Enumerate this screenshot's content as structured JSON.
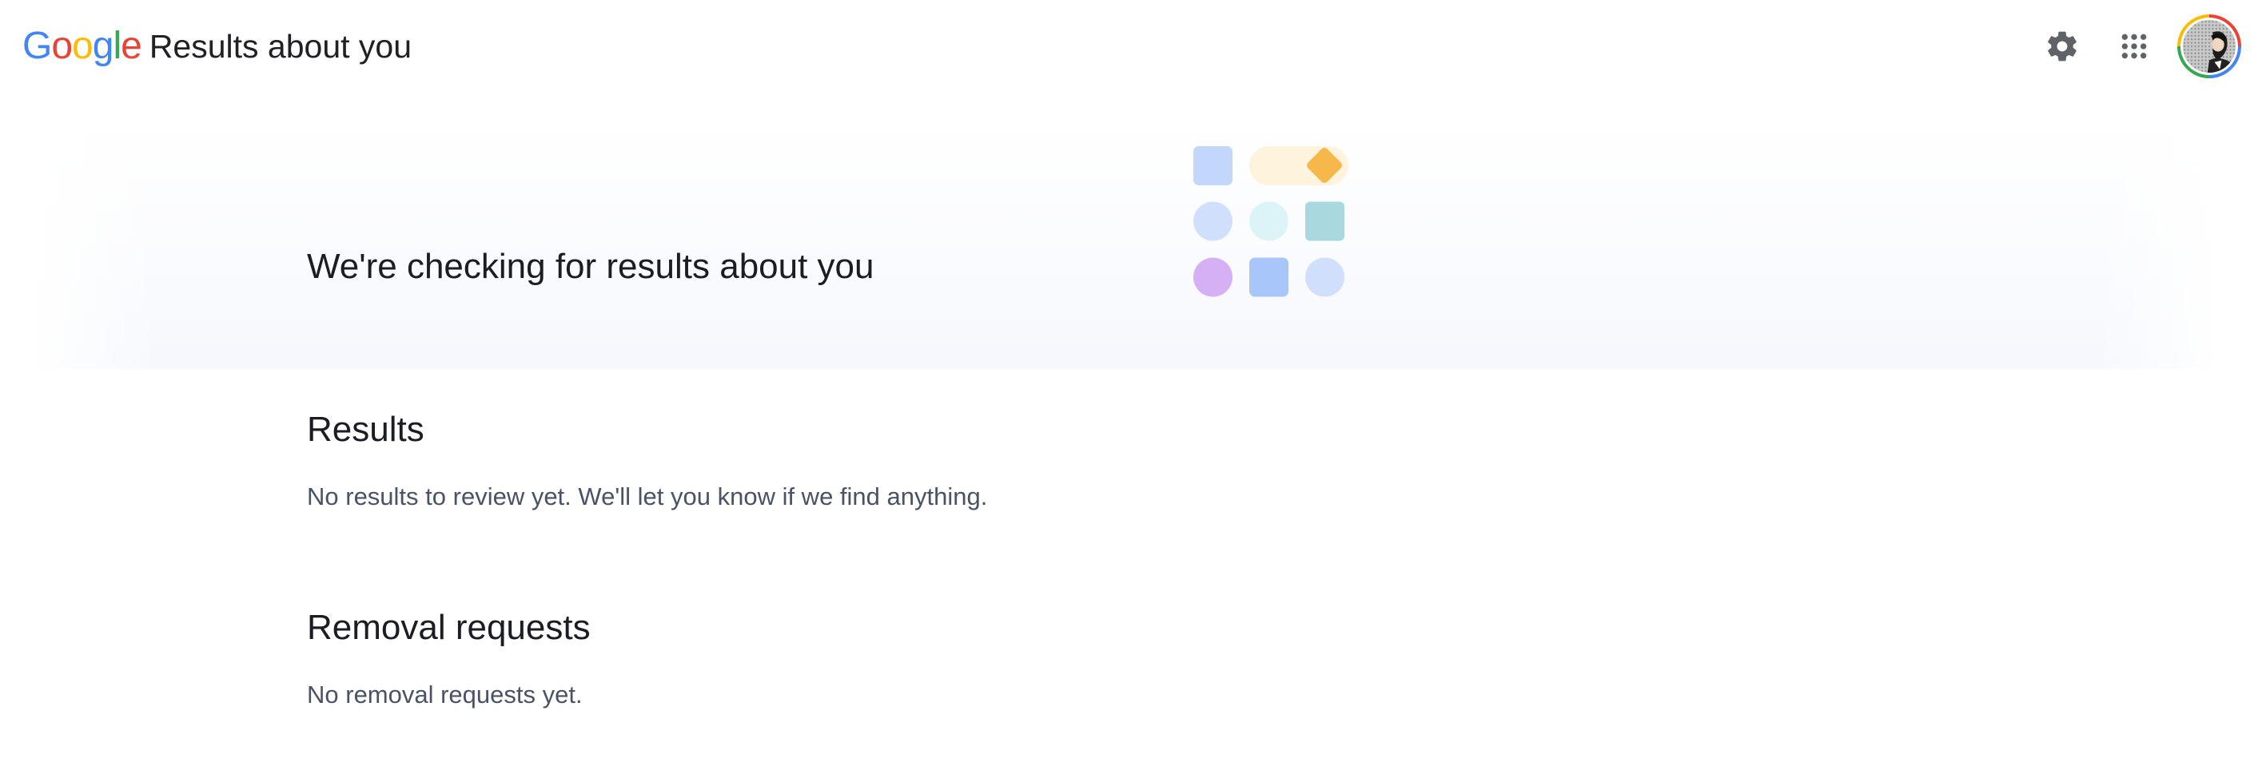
{
  "header": {
    "logo_letters": [
      {
        "char": "G",
        "color": "#4285f4"
      },
      {
        "char": "o",
        "color": "#ea4335"
      },
      {
        "char": "o",
        "color": "#fbbc05"
      },
      {
        "char": "g",
        "color": "#4285f4"
      },
      {
        "char": "l",
        "color": "#34a853"
      },
      {
        "char": "e",
        "color": "#ea4335"
      }
    ],
    "product_title": "Results about you",
    "icons": {
      "settings": "gear-icon",
      "apps": "apps-grid-icon",
      "account": "avatar"
    }
  },
  "hero": {
    "title": "We're checking for results about you",
    "illustration_colors": {
      "blue_square": "#c2d7fb",
      "pill_bg": "#fef3dc",
      "diamond": "#f7b84b",
      "light_blue_circle": "#d0e0fc",
      "cyan_circle": "#dcf3f8",
      "teal_square": "#a9d8df",
      "purple_circle": "#d6b0f5",
      "mid_blue_square": "#a9c6fb",
      "pale_blue_circle": "#d0e0fc"
    }
  },
  "results": {
    "heading": "Results",
    "text": "No results to review yet. We'll let you know if we find anything."
  },
  "removal_requests": {
    "heading": "Removal requests",
    "text": "No removal requests yet."
  }
}
